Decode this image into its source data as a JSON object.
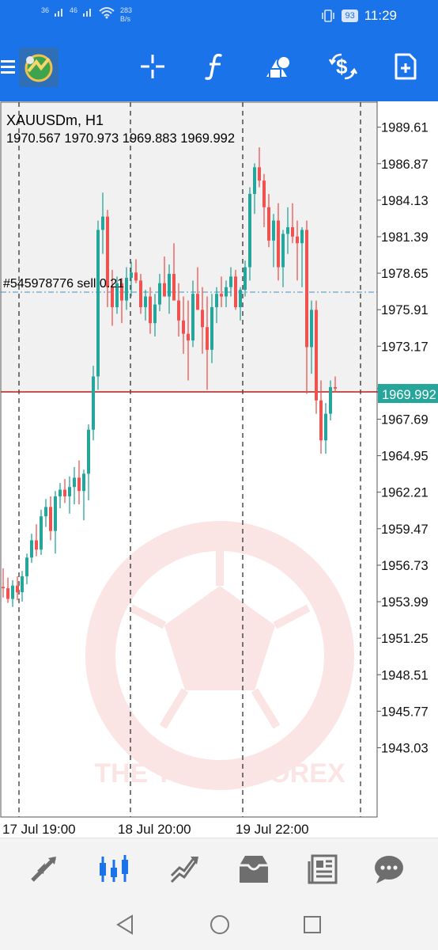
{
  "status_bar": {
    "signal_1": "36",
    "signal_2": "46",
    "net_speed_value": "283",
    "net_speed_unit": "B/s",
    "battery": "93",
    "time": "11:29"
  },
  "toolbar": {
    "icons": [
      "menu-icon",
      "app-logo",
      "crosshair-icon",
      "indicators-icon",
      "objects-icon",
      "trade-icon",
      "new-order-icon"
    ]
  },
  "chart": {
    "header_symbol": "XAUUSDm, H1",
    "header_ohlc": "1970.567 1970.973 1969.883 1969.992",
    "current_price_tag": "1969.992",
    "order_line_label": "#545978776 sell 0.21",
    "x_labels": [
      "17 Jul 19:00",
      "18 Jul 20:00",
      "19 Jul 22:00"
    ],
    "watermark_text": "THE  TRUST  FOREX",
    "colors": {
      "bull": "#26a69a",
      "bear": "#ef5350",
      "price_line": "#b71c1c",
      "order_line": "#4a8fbf",
      "price_tag_bg": "#26a69a"
    }
  },
  "chart_data": {
    "type": "candlestick",
    "title": "XAUUSDm, H1",
    "ylim": [
      1940.8,
      1990.6
    ],
    "y_ticks": [
      "1989.61",
      "1986.87",
      "1984.13",
      "1981.39",
      "1978.65",
      "1975.91",
      "1973.17",
      "1969.99",
      "1967.69",
      "1964.95",
      "1962.21",
      "1959.47",
      "1956.73",
      "1953.99",
      "1951.25",
      "1948.51",
      "1945.77",
      "1943.03"
    ],
    "current_price": 1969.992,
    "order_price": 1976.6,
    "x_tick_labels": [
      "17 Jul 19:00",
      "18 Jul 20:00",
      "19 Jul 22:00"
    ],
    "candles": [
      [
        1955.1,
        1956.5,
        1954.3,
        1955.0
      ],
      [
        1955.0,
        1955.8,
        1953.9,
        1954.2
      ],
      [
        1954.2,
        1955.6,
        1953.6,
        1955.2
      ],
      [
        1955.2,
        1955.9,
        1954.1,
        1954.7
      ],
      [
        1954.7,
        1956.3,
        1954.0,
        1955.9
      ],
      [
        1955.9,
        1957.6,
        1955.3,
        1957.3
      ],
      [
        1957.3,
        1959.1,
        1956.9,
        1958.6
      ],
      [
        1958.6,
        1959.8,
        1957.4,
        1957.9
      ],
      [
        1957.9,
        1960.9,
        1957.5,
        1960.4
      ],
      [
        1960.4,
        1961.7,
        1959.6,
        1961.1
      ],
      [
        1961.1,
        1961.9,
        1958.6,
        1959.3
      ],
      [
        1959.3,
        1962.3,
        1957.6,
        1961.9
      ],
      [
        1961.9,
        1962.9,
        1961.0,
        1962.4
      ],
      [
        1962.4,
        1963.2,
        1961.4,
        1961.9
      ],
      [
        1961.9,
        1963.4,
        1960.6,
        1962.6
      ],
      [
        1962.6,
        1964.1,
        1961.3,
        1963.3
      ],
      [
        1963.3,
        1964.6,
        1961.3,
        1962.3
      ],
      [
        1962.3,
        1963.9,
        1960.1,
        1963.6
      ],
      [
        1963.6,
        1967.3,
        1961.6,
        1966.9
      ],
      [
        1966.9,
        1971.7,
        1966.1,
        1970.9
      ],
      [
        1970.9,
        1982.6,
        1969.9,
        1981.9
      ],
      [
        1981.9,
        1984.7,
        1980.1,
        1982.9
      ],
      [
        1982.9,
        1983.4,
        1976.1,
        1977.6
      ],
      [
        1977.6,
        1978.9,
        1974.7,
        1976.1
      ],
      [
        1976.1,
        1978.4,
        1975.6,
        1977.9
      ],
      [
        1977.9,
        1978.3,
        1974.9,
        1976.6
      ],
      [
        1976.6,
        1979.1,
        1975.9,
        1978.3
      ],
      [
        1978.3,
        1979.5,
        1976.9,
        1978.7
      ],
      [
        1978.7,
        1979.7,
        1977.9,
        1978.1
      ],
      [
        1978.1,
        1978.6,
        1975.6,
        1976.1
      ],
      [
        1976.1,
        1977.4,
        1975.1,
        1976.9
      ],
      [
        1976.9,
        1977.6,
        1974.1,
        1974.9
      ],
      [
        1974.9,
        1977.1,
        1973.9,
        1976.3
      ],
      [
        1976.3,
        1978.6,
        1975.8,
        1977.9
      ],
      [
        1977.9,
        1979.9,
        1976.9,
        1976.9
      ],
      [
        1976.9,
        1979.3,
        1975.6,
        1978.6
      ],
      [
        1978.6,
        1980.9,
        1977.6,
        1976.6
      ],
      [
        1976.6,
        1977.9,
        1973.9,
        1975.1
      ],
      [
        1975.1,
        1976.9,
        1972.6,
        1974.1
      ],
      [
        1974.1,
        1976.6,
        1970.6,
        1973.6
      ],
      [
        1973.6,
        1978.1,
        1973.1,
        1977.1
      ],
      [
        1977.1,
        1979.1,
        1975.9,
        1975.9
      ],
      [
        1975.9,
        1977.6,
        1972.6,
        1974.6
      ],
      [
        1974.6,
        1976.9,
        1969.9,
        1972.9
      ],
      [
        1972.9,
        1977.1,
        1971.9,
        1976.1
      ],
      [
        1976.1,
        1977.6,
        1974.9,
        1977.1
      ],
      [
        1977.1,
        1978.4,
        1976.1,
        1976.9
      ],
      [
        1976.9,
        1978.1,
        1976.1,
        1977.6
      ],
      [
        1977.6,
        1979.1,
        1976.9,
        1978.4
      ],
      [
        1978.4,
        1978.9,
        1975.9,
        1976.1
      ],
      [
        1976.1,
        1977.6,
        1975.1,
        1977.4
      ],
      [
        1977.4,
        1979.6,
        1976.9,
        1979.1
      ],
      [
        1979.1,
        1985.1,
        1978.1,
        1984.6
      ],
      [
        1984.6,
        1986.9,
        1983.1,
        1986.6
      ],
      [
        1986.6,
        1988.1,
        1985.1,
        1985.6
      ],
      [
        1985.6,
        1986.1,
        1982.1,
        1983.6
      ],
      [
        1983.6,
        1984.6,
        1980.6,
        1981.1
      ],
      [
        1981.1,
        1983.1,
        1979.1,
        1982.6
      ],
      [
        1982.6,
        1983.9,
        1978.1,
        1979.1
      ],
      [
        1979.1,
        1981.9,
        1977.6,
        1981.6
      ],
      [
        1981.6,
        1983.6,
        1980.1,
        1982.1
      ],
      [
        1982.1,
        1983.9,
        1980.9,
        1981.4
      ],
      [
        1981.4,
        1982.6,
        1978.1,
        1980.9
      ],
      [
        1980.9,
        1982.1,
        1977.6,
        1981.9
      ],
      [
        1981.9,
        1982.6,
        1969.6,
        1973.1
      ],
      [
        1973.1,
        1976.6,
        1971.1,
        1975.9
      ],
      [
        1975.9,
        1976.6,
        1968.1,
        1969.1
      ],
      [
        1969.1,
        1970.6,
        1965.1,
        1966.1
      ],
      [
        1966.1,
        1968.9,
        1965.1,
        1968.1
      ],
      [
        1968.1,
        1970.6,
        1967.6,
        1970.1
      ],
      [
        1970.1,
        1970.9,
        1969.7,
        1969.99
      ]
    ]
  },
  "bottom_nav": {
    "icons": [
      "quotes-icon",
      "chart-icon",
      "trade-icon",
      "history-icon",
      "news-icon",
      "chat-icon"
    ],
    "active": "chart-icon"
  },
  "system_nav": {
    "icons": [
      "back-icon",
      "home-icon",
      "recents-icon"
    ]
  }
}
